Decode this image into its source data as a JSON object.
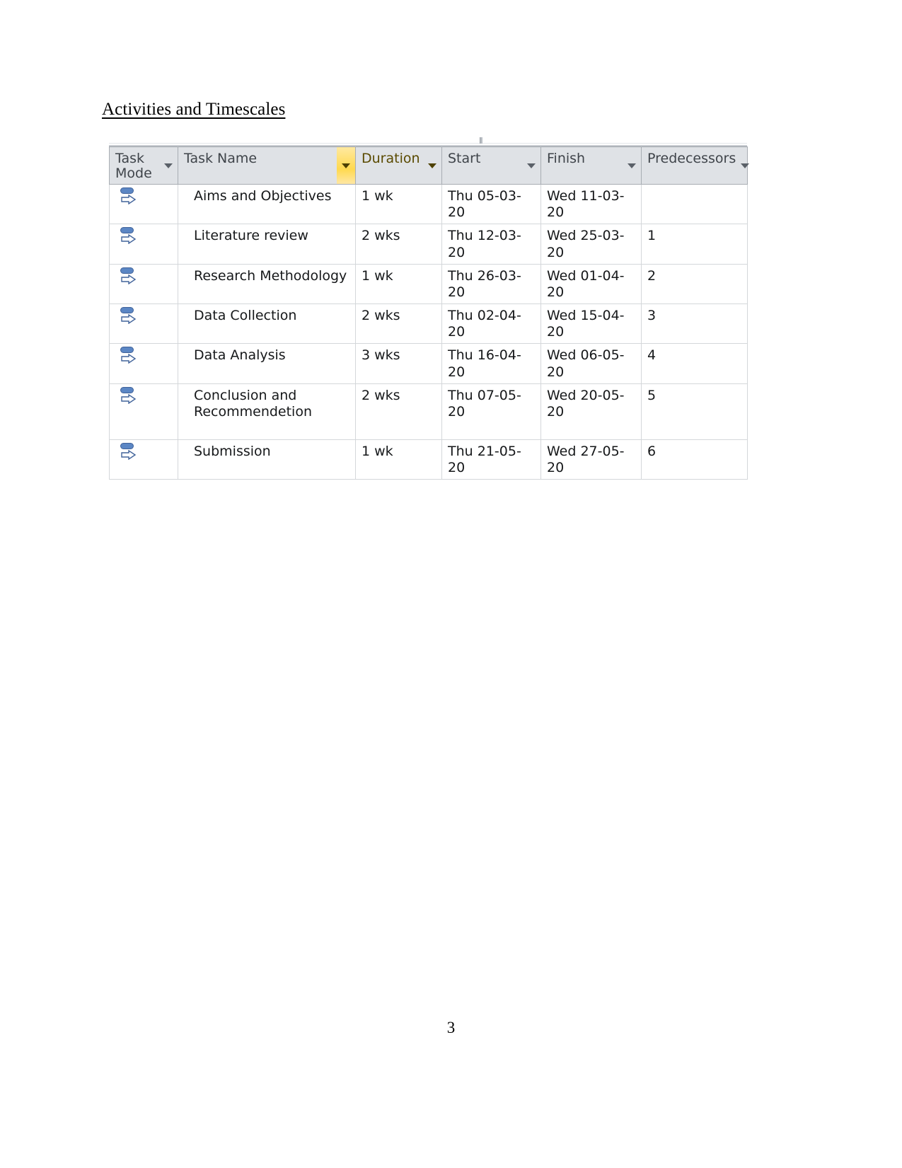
{
  "document": {
    "heading": "Activities and Timescales",
    "page_number": "3"
  },
  "project_table": {
    "columns": [
      {
        "key": "task_mode",
        "label": "Task\nMode",
        "has_filter": true,
        "highlight": "none"
      },
      {
        "key": "task_name",
        "label": "Task Name",
        "has_filter": true,
        "highlight": "filter-gold"
      },
      {
        "key": "duration",
        "label": "Duration",
        "has_filter": true,
        "highlight": "gold"
      },
      {
        "key": "start",
        "label": "Start",
        "has_filter": true,
        "highlight": "none"
      },
      {
        "key": "finish",
        "label": "Finish",
        "has_filter": true,
        "highlight": "none"
      },
      {
        "key": "predecessors",
        "label": "Predecessors",
        "has_filter": true,
        "highlight": "none"
      }
    ],
    "task_mode_icon": "auto-scheduled-icon",
    "filter_icon": "chevron-down-icon",
    "rows": [
      {
        "task_mode": "Auto Scheduled",
        "task_name": "Aims and Objectives",
        "duration": "1 wk",
        "start": "Thu 05-03-20",
        "finish": "Wed 11-03-20",
        "predecessors": ""
      },
      {
        "task_mode": "Auto Scheduled",
        "task_name": "Literature review",
        "duration": "2 wks",
        "start": "Thu 12-03-20",
        "finish": "Wed 25-03-20",
        "predecessors": "1"
      },
      {
        "task_mode": "Auto Scheduled",
        "task_name": "Research Methodology",
        "duration": "1 wk",
        "start": "Thu 26-03-20",
        "finish": "Wed 01-04-20",
        "predecessors": "2"
      },
      {
        "task_mode": "Auto Scheduled",
        "task_name": "Data Collection",
        "duration": "2 wks",
        "start": "Thu 02-04-20",
        "finish": "Wed 15-04-20",
        "predecessors": "3"
      },
      {
        "task_mode": "Auto Scheduled",
        "task_name": "Data Analysis",
        "duration": "3 wks",
        "start": "Thu 16-04-20",
        "finish": "Wed 06-05-20",
        "predecessors": "4"
      },
      {
        "task_mode": "Auto Scheduled",
        "task_name": "Conclusion and\nRecommendetion",
        "duration": "2 wks",
        "start": "Thu 07-05-20",
        "finish": "Wed 20-05-20",
        "predecessors": "5",
        "tall": true
      },
      {
        "task_mode": "Auto Scheduled",
        "task_name": "Submission",
        "duration": "1 wk",
        "start": "Thu 21-05-20",
        "finish": "Wed 27-05-20",
        "predecessors": "6"
      }
    ]
  },
  "colors": {
    "header_background": "#dfe2e6",
    "highlight_gold": "#ffd23c",
    "task_mode_blue": "#5b86c4",
    "grid_line": "#d4d7da",
    "text": "#16181a"
  }
}
